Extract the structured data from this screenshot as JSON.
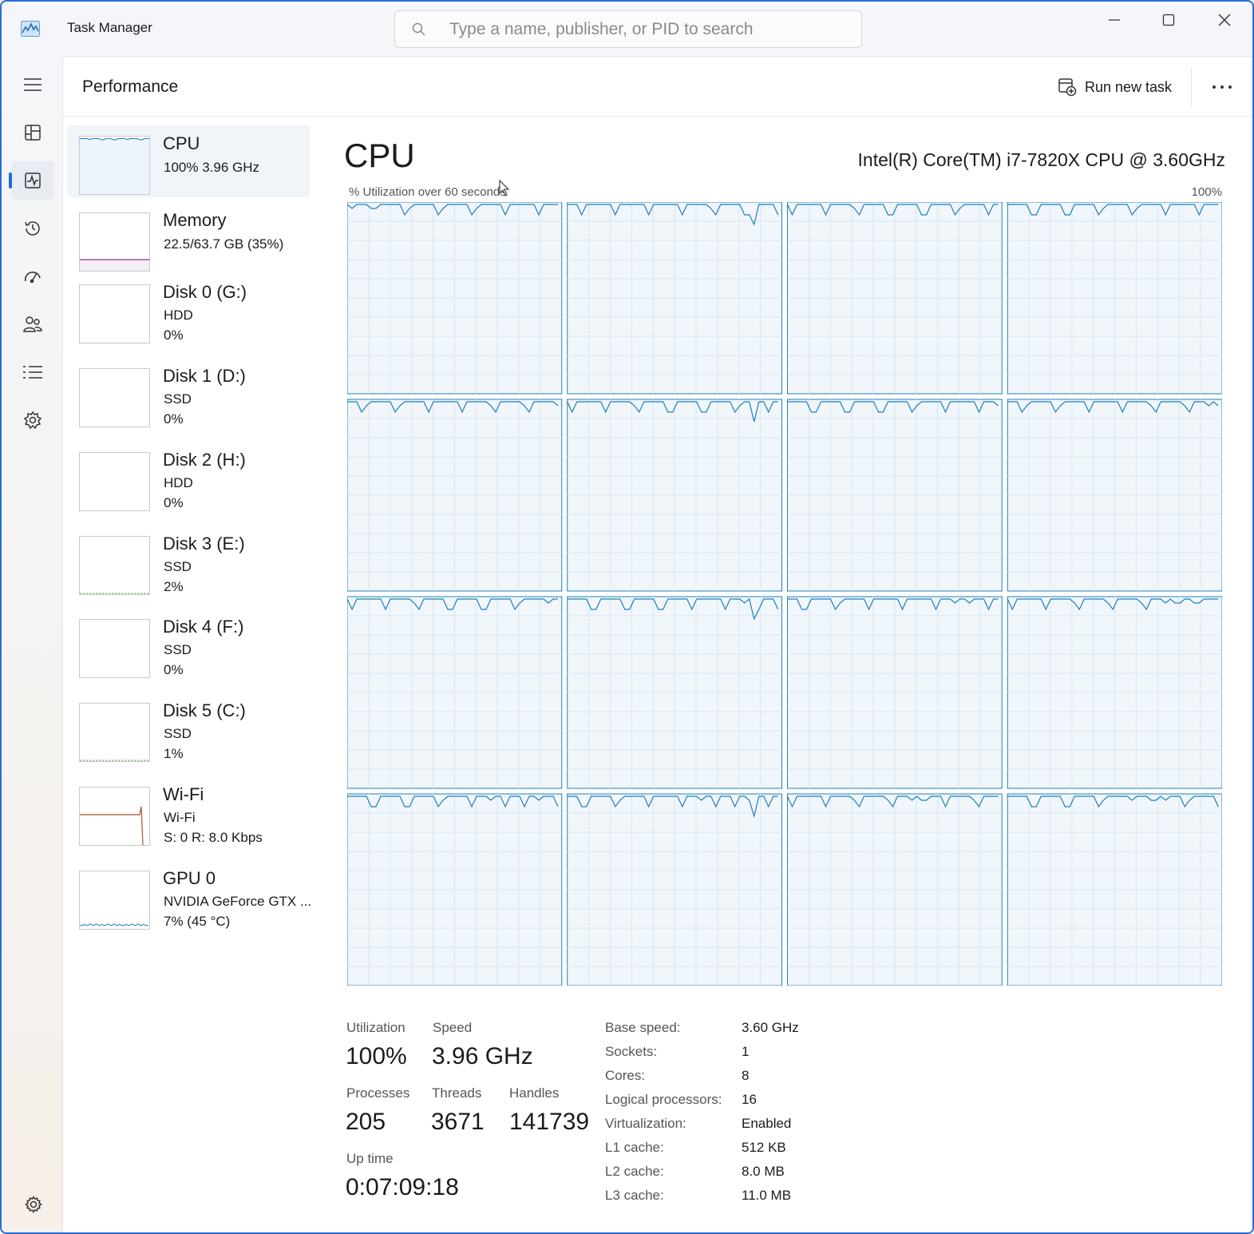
{
  "window": {
    "title": "Task Manager"
  },
  "search": {
    "placeholder": "Type a name, publisher, or PID to search"
  },
  "header": {
    "title": "Performance",
    "run_new_task": "Run new task"
  },
  "rail": {
    "items": [
      {
        "name": "hamburger-menu-icon",
        "icon": "menu"
      },
      {
        "name": "processes-icon",
        "icon": "processes"
      },
      {
        "name": "performance-icon",
        "icon": "performance",
        "active": true
      },
      {
        "name": "app-history-icon",
        "icon": "history"
      },
      {
        "name": "startup-apps-icon",
        "icon": "startup"
      },
      {
        "name": "users-icon",
        "icon": "users"
      },
      {
        "name": "details-icon",
        "icon": "details"
      },
      {
        "name": "services-icon",
        "icon": "services"
      }
    ]
  },
  "resources": [
    {
      "name": "CPU",
      "sub1": "100%  3.96 GHz",
      "sub2": "",
      "graph": "cpu",
      "level": 1.0,
      "color": "#1d80b8",
      "active": true
    },
    {
      "name": "Memory",
      "sub1": "22.5/63.7 GB (35%)",
      "sub2": "",
      "graph": "memory",
      "level": 0.35,
      "color": "#8b2f96"
    },
    {
      "name": "Disk 0 (G:)",
      "sub1": "HDD",
      "sub2": "0%",
      "graph": "disk",
      "level": 0.0,
      "color": "#4a9a1f"
    },
    {
      "name": "Disk 1 (D:)",
      "sub1": "SSD",
      "sub2": "0%",
      "graph": "disk",
      "level": 0.0,
      "color": "#4a9a1f"
    },
    {
      "name": "Disk 2 (H:)",
      "sub1": "HDD",
      "sub2": "0%",
      "graph": "disk",
      "level": 0.0,
      "color": "#4a9a1f"
    },
    {
      "name": "Disk 3 (E:)",
      "sub1": "SSD",
      "sub2": "2%",
      "graph": "disk",
      "level": 0.02,
      "color": "#4a9a1f"
    },
    {
      "name": "Disk 4 (F:)",
      "sub1": "SSD",
      "sub2": "0%",
      "graph": "disk",
      "level": 0.0,
      "color": "#4a9a1f"
    },
    {
      "name": "Disk 5 (C:)",
      "sub1": "SSD",
      "sub2": "1%",
      "graph": "disk",
      "level": 0.01,
      "color": "#4a9a1f"
    },
    {
      "name": "Wi-Fi",
      "sub1": "Wi-Fi",
      "sub2": "S: 0  R: 8.0 Kbps",
      "graph": "wifi",
      "level": 0.0,
      "color": "#a7542a"
    },
    {
      "name": "GPU 0",
      "sub1": "NVIDIA GeForce GTX ...",
      "sub2": "7%  (45 °C)",
      "graph": "gpu",
      "level": 0.07,
      "color": "#1d80b8"
    }
  ],
  "detail": {
    "title": "CPU",
    "model": "Intel(R) Core(TM) i7-7820X CPU @ 3.60GHz",
    "graph_caption": "% Utilization over 60 seconds",
    "graph_max": "100%",
    "logical_cores": 16,
    "line_color": "#1d80b8",
    "fill_color": "#f1f6fb",
    "grid_color": "#d5e6f3"
  },
  "stats": {
    "utilization_label": "Utilization",
    "utilization": "100%",
    "speed_label": "Speed",
    "speed": "3.96 GHz",
    "processes_label": "Processes",
    "processes": "205",
    "threads_label": "Threads",
    "threads": "3671",
    "handles_label": "Handles",
    "handles": "141739",
    "uptime_label": "Up time",
    "uptime": "0:07:09:18"
  },
  "specs": [
    {
      "key": "Base speed:",
      "value": "3.60 GHz"
    },
    {
      "key": "Sockets:",
      "value": "1"
    },
    {
      "key": "Cores:",
      "value": "8"
    },
    {
      "key": "Logical processors:",
      "value": "16"
    },
    {
      "key": "Virtualization:",
      "value": "Enabled"
    },
    {
      "key": "L1 cache:",
      "value": "512 KB"
    },
    {
      "key": "L2 cache:",
      "value": "8.0 MB"
    },
    {
      "key": "L3 cache:",
      "value": "11.0 MB"
    }
  ]
}
